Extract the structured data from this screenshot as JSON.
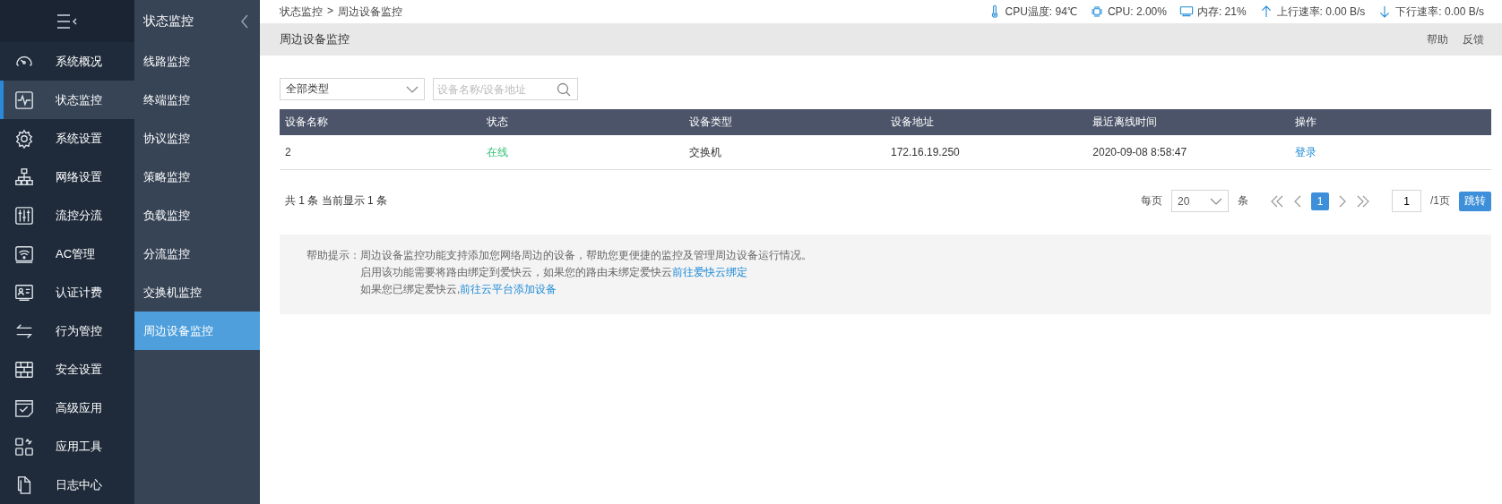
{
  "sidebar": {
    "items": [
      {
        "label": "系统概况",
        "selected": false
      },
      {
        "label": "状态监控",
        "selected": true
      },
      {
        "label": "系统设置",
        "selected": false
      },
      {
        "label": "网络设置",
        "selected": false
      },
      {
        "label": "流控分流",
        "selected": false
      },
      {
        "label": "AC管理",
        "selected": false
      },
      {
        "label": "认证计费",
        "selected": false
      },
      {
        "label": "行为管控",
        "selected": false
      },
      {
        "label": "安全设置",
        "selected": false
      },
      {
        "label": "高级应用",
        "selected": false
      },
      {
        "label": "应用工具",
        "selected": false
      },
      {
        "label": "日志中心",
        "selected": false
      }
    ]
  },
  "submenu": {
    "title": "状态监控",
    "items": [
      {
        "label": "线路监控",
        "selected": false
      },
      {
        "label": "终端监控",
        "selected": false
      },
      {
        "label": "协议监控",
        "selected": false
      },
      {
        "label": "策略监控",
        "selected": false
      },
      {
        "label": "负载监控",
        "selected": false
      },
      {
        "label": "分流监控",
        "selected": false
      },
      {
        "label": "交换机监控",
        "selected": false
      },
      {
        "label": "周边设备监控",
        "selected": true
      }
    ]
  },
  "breadcrumb": [
    "状态监控",
    ">",
    "周边设备监控"
  ],
  "stats": [
    "CPU温度: 94℃",
    "CPU: 2.00%",
    "内存: 21%",
    "上行速率: 0.00 B/s",
    "下行速率: 0.00 B/s"
  ],
  "page_title": "周边设备监控",
  "header_links": [
    "帮助",
    "反馈"
  ],
  "filters": {
    "type_select": "全部类型",
    "search": {
      "placeholder": "设备名称/设备地址"
    }
  },
  "table": {
    "columns": [
      "设备名称",
      "状态",
      "设备类型",
      "设备地址",
      "最近离线时间",
      "操作"
    ],
    "rows": [
      {
        "name": "2",
        "status": "在线",
        "online": true,
        "type": "交换机",
        "address": "172.16.19.250",
        "last_offline": "2020-09-08 8:58:47",
        "action": "登录"
      }
    ]
  },
  "summary": "共 1 条 当前显示 1 条",
  "pagination": {
    "per_page_label": "每页",
    "per_page": "20",
    "unit": "条",
    "pages": [
      {
        "label": "1",
        "selected": true
      }
    ],
    "jump_value": "1",
    "total_pages": "/1页",
    "jump_button": "跳转"
  },
  "help": {
    "label": "帮助提示：",
    "lines": [
      {
        "text": "周边设备监控功能支持添加您网络周边的设备，帮助您更便捷的监控及管理周边设备运行情况。"
      },
      {
        "text": "启用该功能需要将路由绑定到爱快云，如果您的路由未绑定爱快云",
        "link": "前往爱快云绑定"
      },
      {
        "text": "如果您已绑定爱快云,",
        "link": "前往云平台添加设备"
      }
    ]
  }
}
